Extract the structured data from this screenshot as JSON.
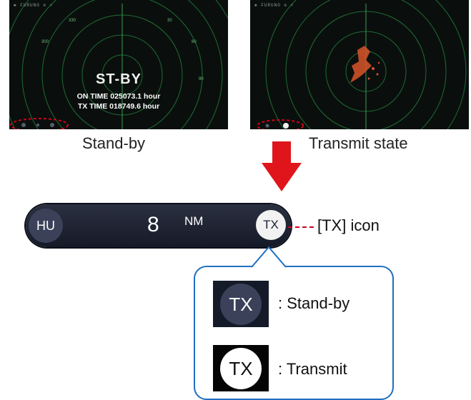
{
  "screen_standby": {
    "toolbar": "✱ FURUNO  ⊕  ⌕",
    "status": "ST-BY",
    "on_time": "ON TIME 025073.1 hour",
    "tx_time": "TX TIME 018749.6 hour"
  },
  "screen_transmit": {
    "toolbar": "✱ FURUNO  ⊕  ⌕"
  },
  "captions": {
    "standby": "Stand-by",
    "transmit": "Transmit state"
  },
  "scale_bar": {
    "mode": "HU",
    "range_value": "8",
    "range_unit": "NM",
    "tx_label": "TX"
  },
  "callout": {
    "label": "[TX] icon"
  },
  "legend": {
    "standby_icon": "TX",
    "standby_text": ": Stand-by",
    "transmit_icon": "TX",
    "transmit_text": ": Transmit"
  },
  "colors": {
    "arrow": "#e0151b",
    "highlight": "#d0021b",
    "legend_border": "#1f6fc1",
    "radar_green": "#2f8f4a",
    "echo": "#d9532c"
  }
}
